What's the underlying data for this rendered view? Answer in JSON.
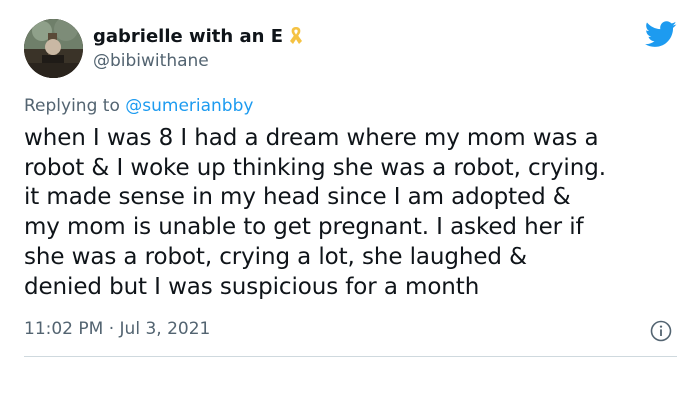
{
  "author": {
    "display_name": "gabrielle with an E",
    "handle": "@bibiwithane"
  },
  "icons": {
    "ribbon": "awareness-ribbon-icon",
    "platform": "twitter-bird-icon",
    "info": "info-icon"
  },
  "colors": {
    "ribbon": "#f5c242",
    "twitter_blue": "#1d9bf0",
    "secondary_text": "#536471"
  },
  "reply": {
    "prefix": "Replying to",
    "mention": "@sumerianbby"
  },
  "tweet": {
    "lines": [
      "when I was 8 I had a dream where my mom was a",
      "robot & I woke up thinking she was a robot, crying.",
      "it made sense in my head since I am adopted &",
      "my mom is unable to get pregnant. I asked her if",
      "she was a robot, crying a lot, she laughed &",
      "denied but I was suspicious for a month"
    ],
    "timestamp": "11:02 PM · Jul 3, 2021"
  }
}
